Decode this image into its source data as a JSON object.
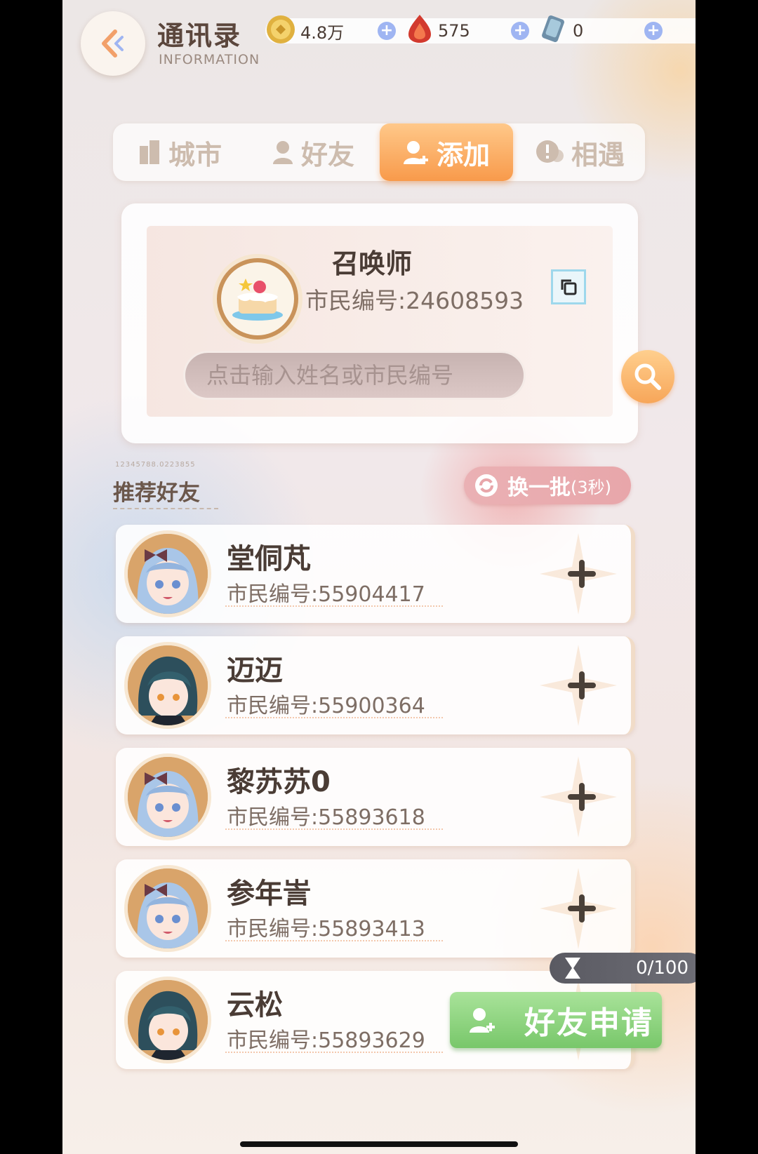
{
  "header": {
    "title": "通讯录",
    "subtitle": "INFORMATION"
  },
  "resources": [
    {
      "icon": "gold-coin-icon",
      "value": "4.8万"
    },
    {
      "icon": "red-crystal-icon",
      "value": "575"
    },
    {
      "icon": "card-ticket-icon",
      "value": "0"
    }
  ],
  "tabs": [
    {
      "label": "城市",
      "icon": "building-icon"
    },
    {
      "label": "好友",
      "icon": "person-icon"
    },
    {
      "label": "添加",
      "icon": "add-person-icon",
      "active": true
    },
    {
      "label": "相遇",
      "icon": "chat-icon"
    }
  ],
  "profile": {
    "name": "召唤师",
    "id_text": "市民编号:24608593",
    "avatar": "cake-icon"
  },
  "search": {
    "placeholder": "点击输入姓名或市民编号"
  },
  "recommend": {
    "title": "推荐好友",
    "serial": "12345788.0223855",
    "refresh_label": "换一批",
    "refresh_timer": "(3秒)"
  },
  "friends": [
    {
      "name": "堂侗芃",
      "id_text": "市民编号:55904417",
      "avatar": "blue-hair-girl"
    },
    {
      "name": "迈迈",
      "id_text": "市民编号:55900364",
      "avatar": "dark-hair-boy"
    },
    {
      "name": "黎苏苏0",
      "id_text": "市民编号:55893618",
      "avatar": "blue-hair-girl"
    },
    {
      "name": "参年訔",
      "id_text": "市民编号:55893413",
      "avatar": "blue-hair-girl"
    },
    {
      "name": "云松",
      "id_text": "市民编号:55893629",
      "avatar": "dark-hair-boy"
    }
  ],
  "bottom": {
    "count": "0/100",
    "apply_label": "好友申请"
  },
  "colors": {
    "accent": "#f89a4b",
    "green": "#78c76a",
    "text": "#4a3c35"
  }
}
